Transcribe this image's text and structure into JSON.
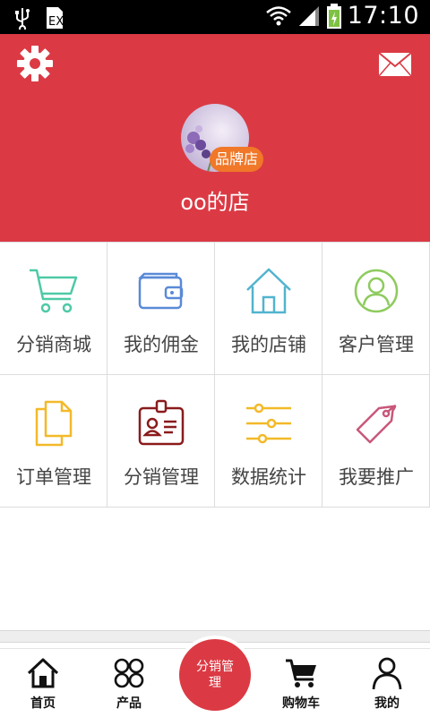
{
  "status_bar": {
    "time": "17:10"
  },
  "header": {
    "shop_name": "oo的店",
    "badge": "品牌店",
    "background_color": "#db3a44"
  },
  "menu": [
    {
      "label": "分销商城",
      "icon": "shopping-cart-icon",
      "color": "#4ec9a6"
    },
    {
      "label": "我的佣金",
      "icon": "wallet-icon",
      "color": "#5a8ad8"
    },
    {
      "label": "我的店铺",
      "icon": "house-icon",
      "color": "#52b4cf"
    },
    {
      "label": "客户管理",
      "icon": "user-circle-icon",
      "color": "#8ecb5e"
    },
    {
      "label": "订单管理",
      "icon": "documents-icon",
      "color": "#f3b928"
    },
    {
      "label": "分销管理",
      "icon": "id-badge-icon",
      "color": "#8a1b1b"
    },
    {
      "label": "数据统计",
      "icon": "sliders-icon",
      "color": "#f3b928"
    },
    {
      "label": "我要推广",
      "icon": "price-tag-icon",
      "color": "#c8577a"
    }
  ],
  "tabbar": {
    "home": "首页",
    "products": "产品",
    "center": "分销管理",
    "cart": "购物车",
    "mine": "我的"
  }
}
